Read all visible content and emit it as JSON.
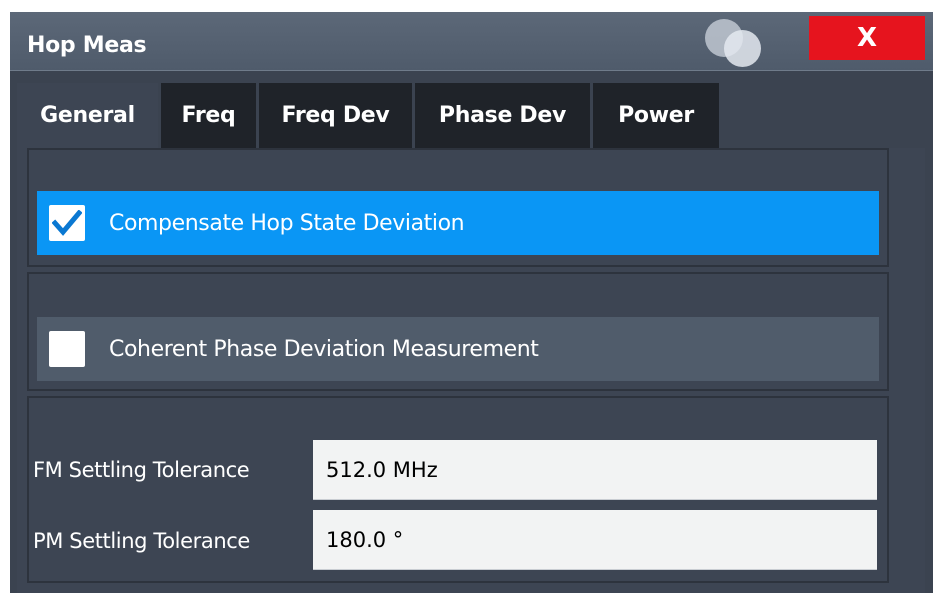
{
  "window": {
    "title": "Hop Meas",
    "close_label": "X"
  },
  "tabs": [
    {
      "label": "General",
      "active": true
    },
    {
      "label": "Freq",
      "active": false
    },
    {
      "label": "Freq Dev",
      "active": false
    },
    {
      "label": "Phase Dev",
      "active": false
    },
    {
      "label": "Power",
      "active": false
    }
  ],
  "options": {
    "compensate": {
      "label": "Compensate Hop State Deviation",
      "checked": true
    },
    "coherent": {
      "label": "Coherent Phase Deviation Measurement",
      "checked": false
    }
  },
  "fields": {
    "fm_settling": {
      "label": "FM Settling Tolerance",
      "value": "512.0 MHz"
    },
    "pm_settling": {
      "label": "PM Settling Tolerance",
      "value": "180.0 °"
    }
  },
  "colors": {
    "selected_row": "#0a96f5",
    "unselected_row": "#505c6b",
    "close_button": "#e6141e",
    "checkmark": "#0a78d2"
  }
}
